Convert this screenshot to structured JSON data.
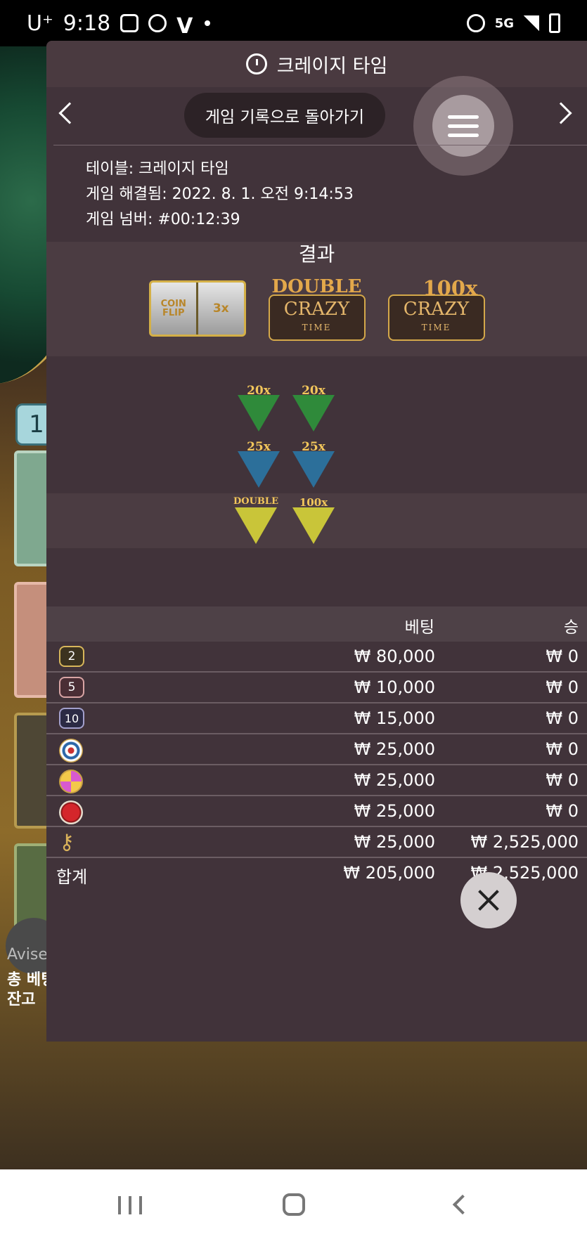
{
  "status_bar": {
    "carrier": "U⁺",
    "time": "9:18",
    "network": "5G",
    "icons": [
      "b-app-icon",
      "shield-app-icon",
      "v-app-icon",
      "notification-dot",
      "alarm-icon",
      "signal-icon",
      "battery-icon"
    ]
  },
  "panel": {
    "title": "크레이지 타임",
    "back_label": "게임 기록으로 돌아가기",
    "info": {
      "table": "테이블: 크레이지 타임",
      "resolved": "게임 해결됨: 2022. 8. 1. 오전 9:14:53",
      "number": "게임 넘버: #00:12:39"
    },
    "result_title": "결과",
    "results": {
      "reel_left": "COIN FLIP",
      "reel_right": "3x",
      "double_top": "DOUBLE",
      "crazy_logo": "CRAZY",
      "crazy_time": "TIME",
      "x100_top": "100x"
    },
    "triangles": [
      {
        "label": "20x",
        "color": "green"
      },
      {
        "label": "20x",
        "color": "green"
      },
      {
        "label": "25x",
        "color": "blue"
      },
      {
        "label": "25x",
        "color": "blue"
      },
      {
        "label": "DOUBLE",
        "color": "yellow"
      },
      {
        "label": "100x",
        "color": "yellow"
      }
    ],
    "table_headers": {
      "bet": "베팅",
      "win": "승"
    },
    "rows": [
      {
        "icon": "chip-2",
        "label": "2",
        "bet": "₩ 80,000",
        "win": "₩ 0"
      },
      {
        "icon": "chip-5",
        "label": "5",
        "bet": "₩ 10,000",
        "win": "₩ 0"
      },
      {
        "icon": "chip-10",
        "label": "10",
        "bet": "₩ 15,000",
        "win": "₩ 0"
      },
      {
        "icon": "target-icon",
        "bet": "₩ 25,000",
        "win": "₩ 0"
      },
      {
        "icon": "candy-icon",
        "bet": "₩ 25,000",
        "win": "₩ 0"
      },
      {
        "icon": "red-ball-icon",
        "bet": "₩ 25,000",
        "win": "₩ 0"
      },
      {
        "icon": "key-icon",
        "bet": "₩ 25,000",
        "win": "₩ 2,525,000"
      }
    ],
    "total": {
      "label": "합계",
      "bet": "₩ 205,000",
      "win": "₩ 2,525,000"
    }
  },
  "background": {
    "badge": "1",
    "chat_line": "Avise",
    "total_bet_label": "총 베팅",
    "balance_label": "잔고"
  },
  "colors": {
    "panel_bg": "#41333a",
    "band_bg": "#4b3c42",
    "gold": "#d4b047"
  }
}
